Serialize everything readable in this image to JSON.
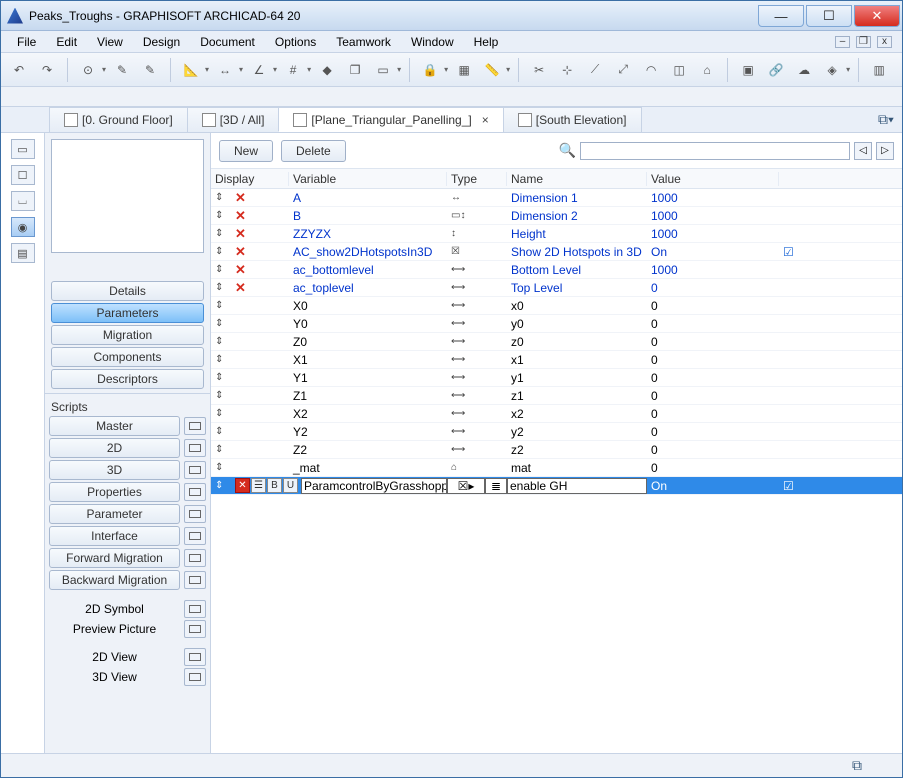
{
  "title": "Peaks_Troughs - GRAPHISOFT ARCHICAD-64 20",
  "menus": [
    "File",
    "Edit",
    "View",
    "Design",
    "Document",
    "Options",
    "Teamwork",
    "Window",
    "Help"
  ],
  "tabs": [
    {
      "label": "[0. Ground Floor]",
      "active": false,
      "closable": false
    },
    {
      "label": "[3D / All]",
      "active": false,
      "closable": false
    },
    {
      "label": "[Plane_Triangular_Panelling_]",
      "active": true,
      "closable": true
    },
    {
      "label": "[South Elevation]",
      "active": false,
      "closable": false
    }
  ],
  "left_panel": {
    "buttons_a": [
      "Details",
      "Parameters",
      "Migration",
      "Components",
      "Descriptors"
    ],
    "selected_a": "Parameters",
    "section_label": "Scripts",
    "buttons_b": [
      "Master",
      "2D",
      "3D",
      "Properties",
      "Parameter",
      "Interface",
      "Forward Migration",
      "Backward Migration"
    ],
    "buttons_c": [
      "2D Symbol",
      "Preview Picture"
    ],
    "buttons_d": [
      "2D View",
      "3D View"
    ]
  },
  "action_buttons": {
    "new": "New",
    "delete": "Delete"
  },
  "search": {
    "placeholder": ""
  },
  "table": {
    "headers": {
      "display": "Display",
      "variable": "Variable",
      "type": "Type",
      "name": "Name",
      "value": "Value"
    },
    "rows": [
      {
        "style": "blue",
        "x": true,
        "variable": "A",
        "type": "↔",
        "name": "Dimension 1",
        "value": "1000",
        "chk": false
      },
      {
        "style": "blue",
        "x": true,
        "variable": "B",
        "type": "▭↕",
        "name": "Dimension 2",
        "value": "1000",
        "chk": false
      },
      {
        "style": "blue",
        "x": true,
        "variable": "ZZYZX",
        "type": "↕",
        "name": "Height",
        "value": "1000",
        "chk": false
      },
      {
        "style": "blue",
        "x": true,
        "variable": "AC_show2DHotspotsIn3D",
        "type": "☒",
        "name": "Show 2D Hotspots in 3D",
        "value": "On",
        "chk": true
      },
      {
        "style": "blue",
        "x": true,
        "variable": "ac_bottomlevel",
        "type": "⟷",
        "name": "Bottom Level",
        "value": "1000",
        "chk": false
      },
      {
        "style": "blue",
        "x": true,
        "variable": "ac_toplevel",
        "type": "⟷",
        "name": "Top Level",
        "value": "0",
        "chk": false
      },
      {
        "style": "black",
        "x": false,
        "variable": "X0",
        "type": "⟷",
        "name": "x0",
        "value": "0",
        "chk": false
      },
      {
        "style": "black",
        "x": false,
        "variable": "Y0",
        "type": "⟷",
        "name": "y0",
        "value": "0",
        "chk": false
      },
      {
        "style": "black",
        "x": false,
        "variable": "Z0",
        "type": "⟷",
        "name": "z0",
        "value": "0",
        "chk": false
      },
      {
        "style": "black",
        "x": false,
        "variable": "X1",
        "type": "⟷",
        "name": "x1",
        "value": "0",
        "chk": false
      },
      {
        "style": "black",
        "x": false,
        "variable": "Y1",
        "type": "⟷",
        "name": "y1",
        "value": "0",
        "chk": false
      },
      {
        "style": "black",
        "x": false,
        "variable": "Z1",
        "type": "⟷",
        "name": "z1",
        "value": "0",
        "chk": false
      },
      {
        "style": "black",
        "x": false,
        "variable": "X2",
        "type": "⟷",
        "name": "x2",
        "value": "0",
        "chk": false
      },
      {
        "style": "black",
        "x": false,
        "variable": "Y2",
        "type": "⟷",
        "name": "y2",
        "value": "0",
        "chk": false
      },
      {
        "style": "black",
        "x": false,
        "variable": "Z2",
        "type": "⟷",
        "name": "z2",
        "value": "0",
        "chk": false
      },
      {
        "style": "black",
        "x": false,
        "variable": "_mat",
        "type": "⌂",
        "name": "mat",
        "value": "0",
        "chk": false
      }
    ],
    "selected_row": {
      "flags": [
        "✕",
        "☰",
        "B",
        "U"
      ],
      "variable": "ParamcontrolByGrasshopper",
      "typeA": "☒▸",
      "typeB": "≣",
      "name": "enable GH",
      "value": "On",
      "chk": true
    }
  }
}
